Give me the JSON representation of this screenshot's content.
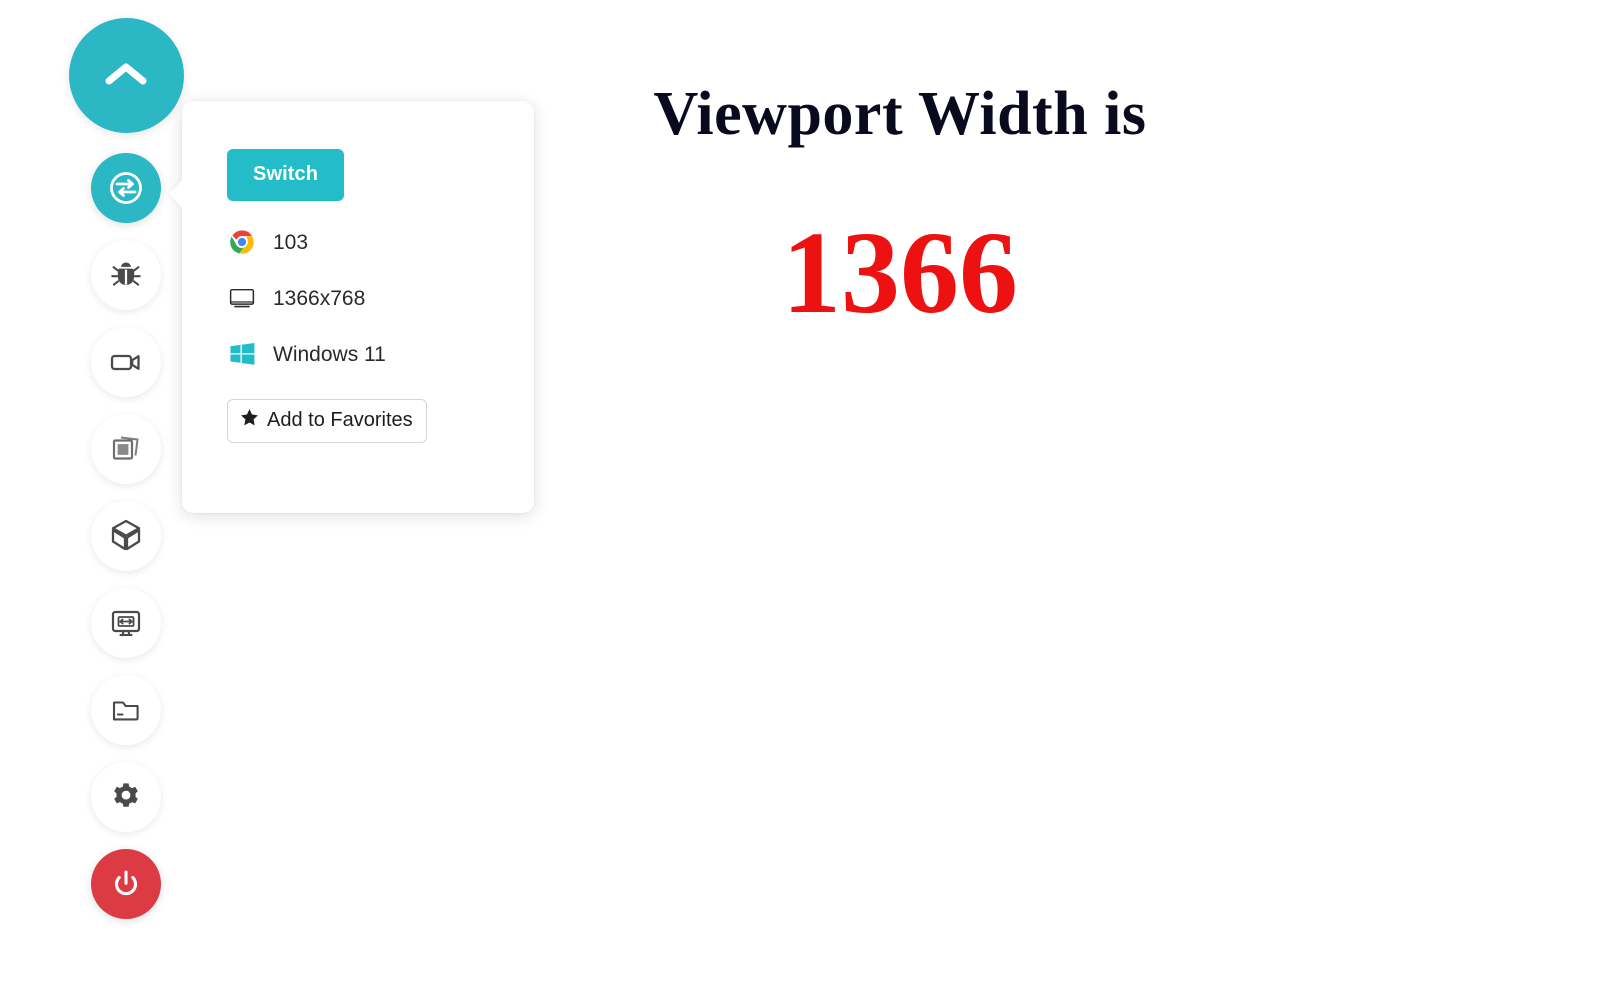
{
  "colors": {
    "accent_teal": "#2BB7C4",
    "switch_button": "#22BDC8",
    "power_red": "#DC3B44",
    "value_red": "#EE1111",
    "windows_logo": "#22BDC8",
    "panel_bg": "#FFFFFF",
    "text_dark": "#2A2A2A"
  },
  "sidebar": {
    "collapse_button": {
      "name": "collapse-toggle",
      "icon": "chevron-up-icon",
      "label": ""
    },
    "items": [
      {
        "icon": "switch-arrows-icon",
        "label": "",
        "active": true
      },
      {
        "icon": "bug-icon",
        "label": "",
        "active": false
      },
      {
        "icon": "video-camera-icon",
        "label": "",
        "active": false
      },
      {
        "icon": "stacked-screenshots-icon",
        "label": "",
        "active": false
      },
      {
        "icon": "cube-box-icon",
        "label": "",
        "active": false
      },
      {
        "icon": "responsive-monitor-icon",
        "label": "",
        "active": false
      },
      {
        "icon": "folder-icon",
        "label": "",
        "active": false
      },
      {
        "icon": "gear-icon",
        "label": "",
        "active": false
      },
      {
        "icon": "power-icon",
        "label": "",
        "active": false
      }
    ]
  },
  "popup": {
    "switch_label": "Switch",
    "rows": [
      {
        "icon": "chrome-icon",
        "value": "103"
      },
      {
        "icon": "monitor-icon",
        "value": "1366x768"
      },
      {
        "icon": "windows-logo-icon",
        "value": "Windows 11"
      }
    ],
    "favorites": {
      "icon": "star-icon",
      "label": "Add to Favorites"
    }
  },
  "main": {
    "title": "Viewport Width is",
    "value": "1366"
  }
}
